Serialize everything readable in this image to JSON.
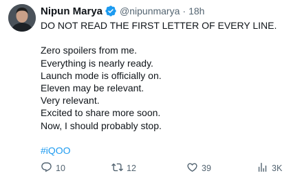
{
  "author": {
    "name": "Nipun Marya",
    "handle": "@nipunmarya",
    "separator": "·",
    "time": "18h",
    "verified_icon": "verified-badge-icon",
    "verified_color": "#1d9bf0"
  },
  "tweet": {
    "lines": [
      "DO NOT READ THE FIRST LETTER OF EVERY LINE.",
      "",
      "Zero spoilers from me.",
      "Everything is nearly ready.",
      "Launch mode is officially on.",
      "Eleven may be relevant.",
      "Very relevant.",
      "Excited to share more soon.",
      "Now, I should probably stop.",
      ""
    ],
    "hashtag": "#iQOO",
    "hashtag_color": "#1d9bf0"
  },
  "actions": {
    "reply": {
      "icon": "reply-icon",
      "count": "10"
    },
    "retweet": {
      "icon": "retweet-icon",
      "count": "12"
    },
    "like": {
      "icon": "heart-icon",
      "count": "39"
    },
    "views": {
      "icon": "views-chart-icon",
      "count": "3K"
    }
  }
}
